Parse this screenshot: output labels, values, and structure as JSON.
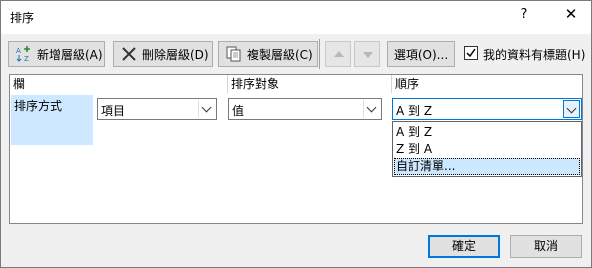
{
  "window": {
    "title": "排序",
    "help_label": "?",
    "close_label": "✕"
  },
  "toolbar": {
    "add_level": "新增層級(A)",
    "delete_level": "刪除層級(D)",
    "copy_level": "複製層級(C)",
    "options": "選項(O)...",
    "has_headers_label": "我的資料有標題(H)",
    "has_headers_checked": true
  },
  "grid": {
    "headers": {
      "column": "欄",
      "sort_on": "排序對象",
      "order": "順序"
    },
    "row": {
      "label": "排序方式",
      "column_value": "項目",
      "sort_on_value": "值",
      "order_value": "A 到 Z"
    }
  },
  "order_dropdown": {
    "options": [
      "A 到 Z",
      "Z 到 A",
      "自訂清單..."
    ],
    "highlighted_index": 2
  },
  "footer": {
    "ok": "確定",
    "cancel": "取消"
  },
  "colors": {
    "accent": "#0078d7",
    "selection": "#cce8ff",
    "row_header": "#cde8ff"
  }
}
